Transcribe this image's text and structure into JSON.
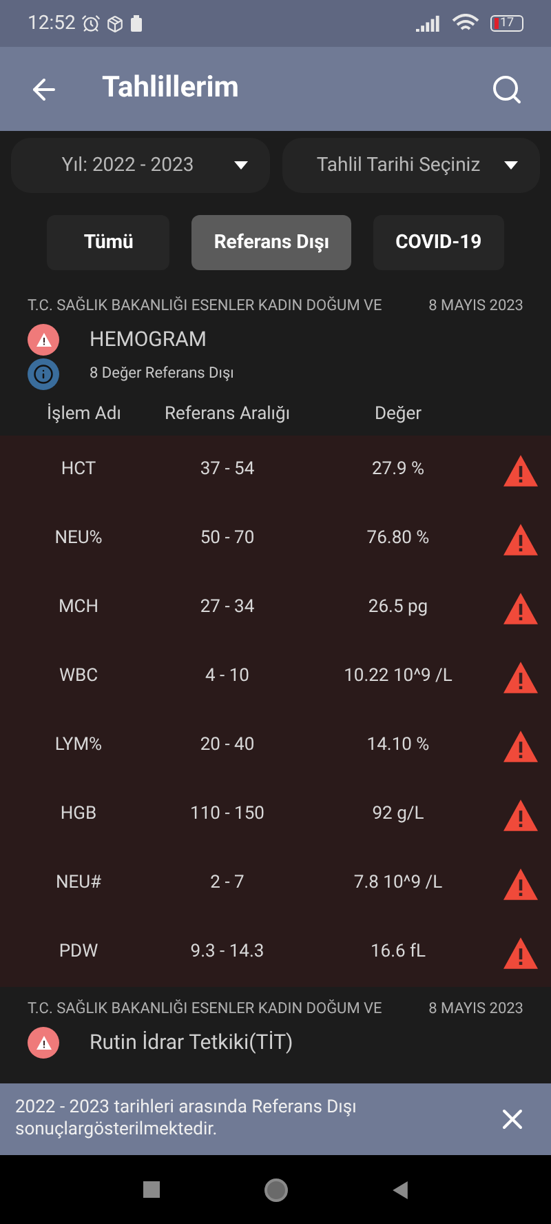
{
  "status_bar": {
    "time": "12:52",
    "battery": "17"
  },
  "app_bar": {
    "title": "Tahlillerim"
  },
  "filters": [
    {
      "value": "Yıl: 2022 - 2023"
    },
    {
      "value": "Tahlil Tarihi Seçiniz"
    }
  ],
  "tabs": [
    {
      "label": "Tümü",
      "selected": false
    },
    {
      "label": "Referans Dışı",
      "selected": true
    },
    {
      "label": "COVID-19",
      "selected": false
    }
  ],
  "cards": [
    {
      "hospital": "T.C. SAĞLIK BAKANLIĞI ESENLER KADIN DOĞUM VE",
      "date": "8 MAYIS 2023",
      "test": "HEMOGRAM",
      "note": "8 Değer Referans Dışı",
      "columns": [
        "İşlem Adı",
        "Referans Aralığı",
        "Değer"
      ],
      "rows": [
        {
          "name": "HCT",
          "range": "37 - 54",
          "value": "27.9 %",
          "abnormal": true
        },
        {
          "name": "NEU%",
          "range": "50 - 70",
          "value": "76.80 %",
          "abnormal": true
        },
        {
          "name": "MCH",
          "range": "27 - 34",
          "value": "26.5 pg",
          "abnormal": true
        },
        {
          "name": "WBC",
          "range": "4 - 10",
          "value": "10.22 10^9 /L",
          "abnormal": true
        },
        {
          "name": "LYM%",
          "range": "20 - 40",
          "value": "14.10 %",
          "abnormal": true
        },
        {
          "name": "HGB",
          "range": "110 - 150",
          "value": "92 g/L",
          "abnormal": true
        },
        {
          "name": "NEU#",
          "range": "2 - 7",
          "value": "7.8 10^9 /L",
          "abnormal": true
        },
        {
          "name": "PDW",
          "range": "9.3 - 14.3",
          "value": "16.6 fL",
          "abnormal": true
        }
      ]
    },
    {
      "hospital": "T.C. SAĞLIK BAKANLIĞI ESENLER KADIN DOĞUM VE",
      "date": "8 MAYIS 2023",
      "test": "Rutin İdrar Tetkiki(TİT)"
    }
  ],
  "snackbar": {
    "message": "2022 - 2023 tarihleri arasında Referans Dışı sonuçlargösterilmektedir."
  }
}
